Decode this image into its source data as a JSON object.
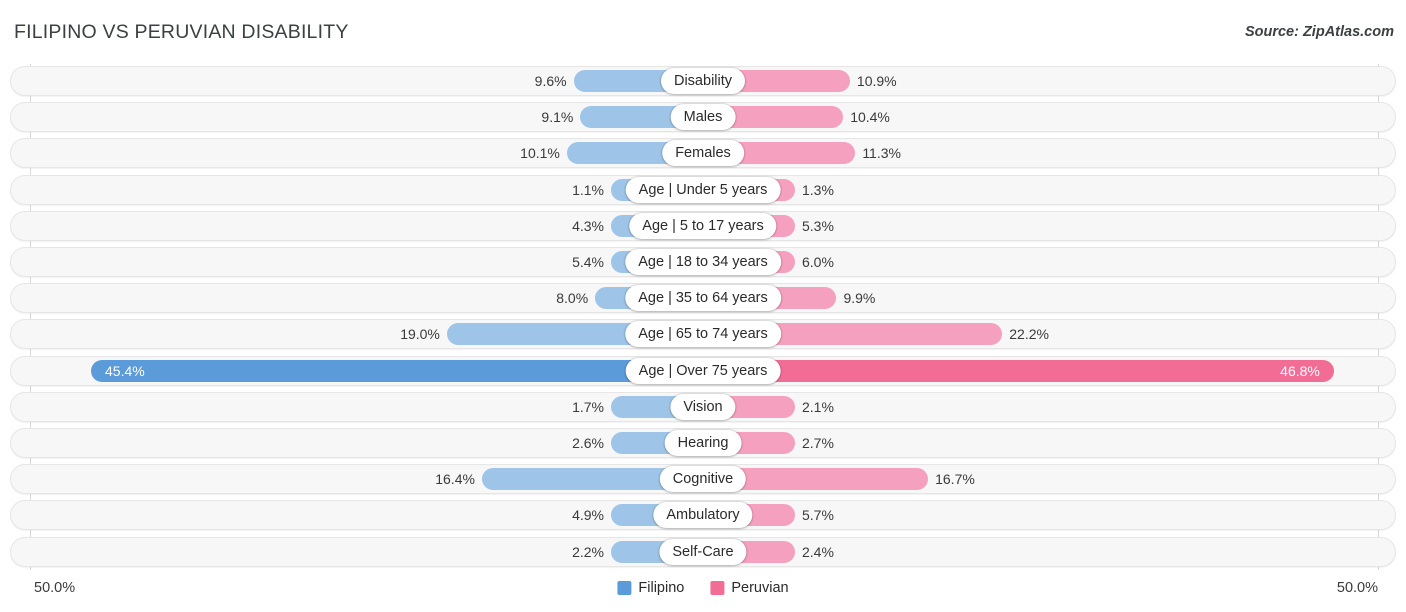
{
  "header": {
    "title": "FILIPINO VS PERUVIAN DISABILITY",
    "source": "Source: ZipAtlas.com"
  },
  "footer": {
    "axis_min": "50.0%",
    "axis_max": "50.0%",
    "legend": [
      {
        "label": "Filipino",
        "color": "#5b9bd9"
      },
      {
        "label": "Peruvian",
        "color": "#f26d96"
      }
    ]
  },
  "colors": {
    "left_normal": "#9ec4e8",
    "left_highlight": "#5b9bd9",
    "right_normal": "#f5a0bf",
    "right_highlight": "#f26d96",
    "track": "#f7f7f7",
    "axis": "#d8d8d8"
  },
  "chart_data": {
    "type": "bar",
    "subtype": "diverging-bidirectional-bar",
    "title": "FILIPINO VS PERUVIAN DISABILITY",
    "xlabel": "",
    "ylabel": "",
    "xlim": [
      -50.0,
      50.0
    ],
    "axis_min_label": "50.0%",
    "axis_max_label": "50.0%",
    "grid": false,
    "legend_position": "bottom-center",
    "categories": [
      "Disability",
      "Males",
      "Females",
      "Age | Under 5 years",
      "Age | 5 to 17 years",
      "Age | 18 to 34 years",
      "Age | 35 to 64 years",
      "Age | 65 to 74 years",
      "Age | Over 75 years",
      "Vision",
      "Hearing",
      "Cognitive",
      "Ambulatory",
      "Self-Care"
    ],
    "series": [
      {
        "name": "Filipino",
        "side": "left",
        "color": "#9ec4e8",
        "values": [
          9.6,
          9.1,
          10.1,
          1.1,
          4.3,
          5.4,
          8.0,
          19.0,
          45.4,
          1.7,
          2.6,
          16.4,
          4.9,
          2.2
        ],
        "labels": [
          "9.6%",
          "9.1%",
          "10.1%",
          "1.1%",
          "4.3%",
          "5.4%",
          "8.0%",
          "19.0%",
          "45.4%",
          "1.7%",
          "2.6%",
          "16.4%",
          "4.9%",
          "2.2%"
        ]
      },
      {
        "name": "Peruvian",
        "side": "right",
        "color": "#f5a0bf",
        "values": [
          10.9,
          10.4,
          11.3,
          1.3,
          5.3,
          6.0,
          9.9,
          22.2,
          46.8,
          2.1,
          2.7,
          16.7,
          5.7,
          2.4
        ],
        "labels": [
          "10.9%",
          "10.4%",
          "11.3%",
          "1.3%",
          "5.3%",
          "6.0%",
          "9.9%",
          "22.2%",
          "46.8%",
          "2.1%",
          "2.7%",
          "16.7%",
          "5.7%",
          "2.4%"
        ]
      }
    ]
  },
  "rows": [
    {
      "label": "Disability",
      "left_value": 9.6,
      "left_label": "9.6%",
      "right_value": 10.9,
      "right_label": "10.9%",
      "highlight": false
    },
    {
      "label": "Males",
      "left_value": 9.1,
      "left_label": "9.1%",
      "right_value": 10.4,
      "right_label": "10.4%",
      "highlight": false
    },
    {
      "label": "Females",
      "left_value": 10.1,
      "left_label": "10.1%",
      "right_value": 11.3,
      "right_label": "11.3%",
      "highlight": false
    },
    {
      "label": "Age | Under 5 years",
      "left_value": 1.1,
      "left_label": "1.1%",
      "right_value": 1.3,
      "right_label": "1.3%",
      "highlight": false
    },
    {
      "label": "Age | 5 to 17 years",
      "left_value": 4.3,
      "left_label": "4.3%",
      "right_value": 5.3,
      "right_label": "5.3%",
      "highlight": false
    },
    {
      "label": "Age | 18 to 34 years",
      "left_value": 5.4,
      "left_label": "5.4%",
      "right_value": 6.0,
      "right_label": "6.0%",
      "highlight": false
    },
    {
      "label": "Age | 35 to 64 years",
      "left_value": 8.0,
      "left_label": "8.0%",
      "right_value": 9.9,
      "right_label": "9.9%",
      "highlight": false
    },
    {
      "label": "Age | 65 to 74 years",
      "left_value": 19.0,
      "left_label": "19.0%",
      "right_value": 22.2,
      "right_label": "22.2%",
      "highlight": false
    },
    {
      "label": "Age | Over 75 years",
      "left_value": 45.4,
      "left_label": "45.4%",
      "right_value": 46.8,
      "right_label": "46.8%",
      "highlight": true
    },
    {
      "label": "Vision",
      "left_value": 1.7,
      "left_label": "1.7%",
      "right_value": 2.1,
      "right_label": "2.1%",
      "highlight": false
    },
    {
      "label": "Hearing",
      "left_value": 2.6,
      "left_label": "2.6%",
      "right_value": 2.7,
      "right_label": "2.7%",
      "highlight": false
    },
    {
      "label": "Cognitive",
      "left_value": 16.4,
      "left_label": "16.4%",
      "right_value": 16.7,
      "right_label": "16.7%",
      "highlight": false
    },
    {
      "label": "Ambulatory",
      "left_value": 4.9,
      "left_label": "4.9%",
      "right_value": 5.7,
      "right_label": "5.7%",
      "highlight": false
    },
    {
      "label": "Self-Care",
      "left_value": 2.2,
      "left_label": "2.2%",
      "right_value": 2.4,
      "right_label": "2.4%",
      "highlight": false
    }
  ]
}
